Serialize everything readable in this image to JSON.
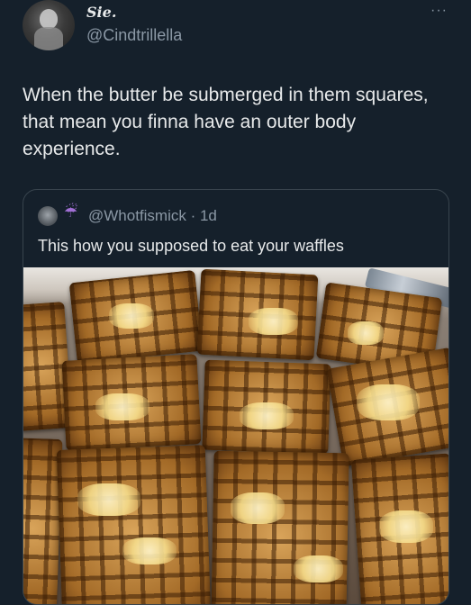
{
  "author": {
    "display_name": "Sie.",
    "handle": "@Cindtrillella"
  },
  "menu": {
    "more_icon": "more-options-icon",
    "more_glyph": "···"
  },
  "tweet": {
    "text": "When the butter be submerged in them squares, that mean you finna have an outer body experience."
  },
  "quoted_tweet": {
    "emoji": "☔",
    "handle_time": "@Whotfismick · 1d",
    "text": "This how you supposed to eat your waffles"
  },
  "colors": {
    "background": "#15202b",
    "primary_text": "#e7e9ea",
    "secondary_text": "#8b98a5",
    "border": "#38444d"
  }
}
